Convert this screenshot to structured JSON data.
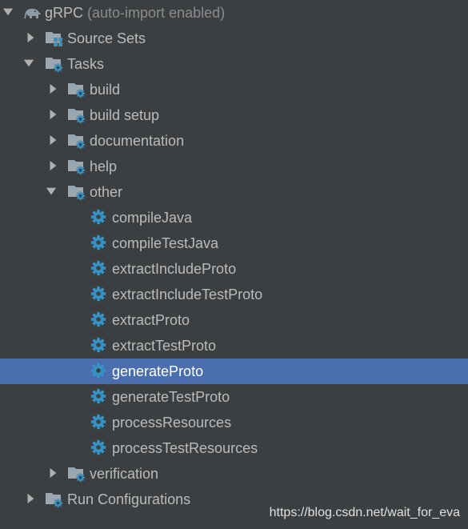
{
  "tree": {
    "root": {
      "label": "gRPC",
      "suffix": "(auto-import enabled)",
      "icon": "gradle-elephant-icon"
    },
    "source_sets": {
      "label": "Source Sets",
      "icon": "source-sets-folder-icon"
    },
    "tasks": {
      "label": "Tasks",
      "icon": "gear-folder-icon"
    },
    "task_groups": [
      {
        "label": "build"
      },
      {
        "label": "build setup"
      },
      {
        "label": "documentation"
      },
      {
        "label": "help"
      },
      {
        "label": "other"
      }
    ],
    "other_tasks": [
      {
        "label": "compileJava",
        "selected": false
      },
      {
        "label": "compileTestJava",
        "selected": false
      },
      {
        "label": "extractIncludeProto",
        "selected": false
      },
      {
        "label": "extractIncludeTestProto",
        "selected": false
      },
      {
        "label": "extractProto",
        "selected": false
      },
      {
        "label": "extractTestProto",
        "selected": false
      },
      {
        "label": "generateProto",
        "selected": true
      },
      {
        "label": "generateTestProto",
        "selected": false
      },
      {
        "label": "processResources",
        "selected": false
      },
      {
        "label": "processTestResources",
        "selected": false
      }
    ],
    "verification": {
      "label": "verification"
    },
    "run_configurations": {
      "label": "Run Configurations"
    }
  },
  "watermark": "https://blog.csdn.net/wait_for_eva",
  "colors": {
    "background": "#3c3f41",
    "selection": "#4b6eaf",
    "text": "#bbbbbb",
    "gear": "#3592c4",
    "folder": "#9aa7b0"
  }
}
